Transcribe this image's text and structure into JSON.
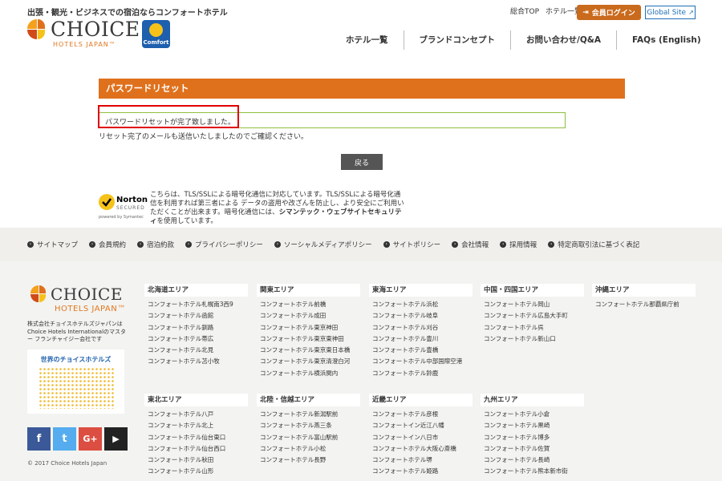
{
  "header": {
    "tagline": "出張・観光・ビジネスでの宿泊ならコンフォートホテル",
    "logo_word": "CHOICE",
    "logo_sub": "HOTELS JAPAN™",
    "comfort_badge": "Comfort",
    "top_links": [
      "総合TOP",
      "ホテル一覧"
    ],
    "login_label": "会員ログイン",
    "global_label": "Global Site",
    "nav": [
      "ホテル一覧",
      "ブランドコンセプト",
      "お問い合わせ/Q&A",
      "FAQs (English)"
    ]
  },
  "content": {
    "section_title": "パスワードリセット",
    "message": "パスワードリセットが完了致しました。",
    "sub_message": "リセット完了のメールも送信いたしましたのでご確認ください。",
    "back_label": "戻る",
    "norton_word": "Norton",
    "norton_secured": "SECURED",
    "norton_powered": "powered by Symantec",
    "ssl_text": "こちらは、TLS/SSLによる暗号化通信に対応しています。TLS/SSLによる暗号化通信を利用すれば第三者による データの盗用や改ざんを防止し、より安全にご利用いただくことが出来ます。暗号化通信には、",
    "ssl_bold": "シマンテック・ウェブサイトセキュリティ",
    "ssl_tail": "を使用しています。"
  },
  "footer_links": [
    "サイトマップ",
    "会員規約",
    "宿泊約款",
    "プライバシーポリシー",
    "ソーシャルメディアポリシー",
    "サイトポリシー",
    "会社情報",
    "採用情報",
    "特定商取引法に基づく表記"
  ],
  "footer": {
    "logo_word": "CHOICE",
    "logo_sub": "HOTELS JAPAN™",
    "company": "株式会社チョイスホテルズジャパンは Choice Hotels Internationalのマスター フランチャイジー会社です",
    "world_title": "世界のチョイスホテルズ",
    "social": [
      "f",
      "t",
      "G+",
      "▶"
    ],
    "copyright": "© 2017 Choice Hotels Japan",
    "areas": [
      {
        "title": "北海道エリア",
        "hotels": [
          "コンフォートホテル札幌南3西9",
          "コンフォートホテル函館",
          "コンフォートホテル釧路",
          "コンフォートホテル帯広",
          "コンフォートホテル北見",
          "コンフォートホテル苫小牧"
        ]
      },
      {
        "title": "関東エリア",
        "hotels": [
          "コンフォートホテル前橋",
          "コンフォートホテル成田",
          "コンフォートホテル東京神田",
          "コンフォートホテル東京東神田",
          "コンフォートホテル東京東日本橋",
          "コンフォートホテル東京清澄白河",
          "コンフォートホテル横浜関内"
        ]
      },
      {
        "title": "東海エリア",
        "hotels": [
          "コンフォートホテル浜松",
          "コンフォートホテル岐阜",
          "コンフォートホテル刈谷",
          "コンフォートホテル豊川",
          "コンフォートホテル豊橋",
          "コンフォートホテル中部国際空港",
          "コンフォートホテル鈴鹿"
        ]
      },
      {
        "title": "中国・四国エリア",
        "hotels": [
          "コンフォートホテル岡山",
          "コンフォートホテル広島大手町",
          "コンフォートホテル呉",
          "コンフォートホテル新山口"
        ]
      },
      {
        "title": "沖縄エリア",
        "hotels": [
          "コンフォートホテル那覇県庁前"
        ]
      },
      {
        "title": "東北エリア",
        "hotels": [
          "コンフォートホテル八戸",
          "コンフォートホテル北上",
          "コンフォートホテル仙台東口",
          "コンフォートホテル仙台西口",
          "コンフォートホテル秋田",
          "コンフォートホテル山形"
        ]
      },
      {
        "title": "北陸・信越エリア",
        "hotels": [
          "コンフォートホテル新潟駅前",
          "コンフォートホテル燕三条",
          "コンフォートホテル富山駅前",
          "コンフォートホテル小松",
          "コンフォートホテル長野"
        ]
      },
      {
        "title": "近畿エリア",
        "hotels": [
          "コンフォートホテル彦根",
          "コンフォートイン近江八幡",
          "コンフォートイン八日市",
          "コンフォートホテル大阪心斎橋",
          "コンフォートホテル堺",
          "コンフォートホテル姫路"
        ]
      },
      {
        "title": "九州エリア",
        "hotels": [
          "コンフォートホテル小倉",
          "コンフォートホテル黒崎",
          "コンフォートホテル博多",
          "コンフォートホテル佐賀",
          "コンフォートホテル長崎",
          "コンフォートホテル熊本新市街"
        ]
      }
    ]
  },
  "colors": {
    "brand_orange": "#e0711c",
    "brand_blue": "#1e5fae",
    "highlight_red": "#e00000",
    "msg_border_green": "#8fc03f"
  }
}
